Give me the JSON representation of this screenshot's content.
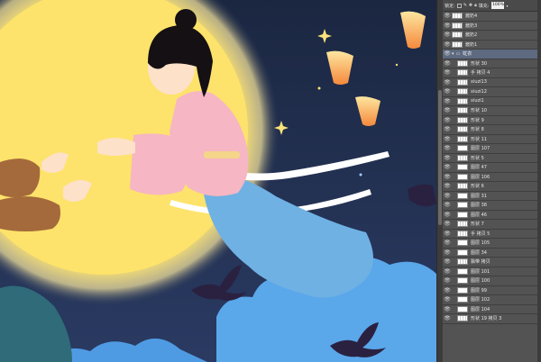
{
  "canvas": {
    "colors": {
      "sky": "#1f2d4a",
      "moon": "#fde36b",
      "cloud": "#5aa7ea",
      "lantern": "#f79a48",
      "robe_top": "#f6b6c3",
      "robe_skirt": "#6fb1e3"
    }
  },
  "panel": {
    "lock_label": "锁定:",
    "fill_label": "填充:",
    "fill_value": "100%",
    "layers": [
      {
        "name": "酱奶4",
        "type": "shape",
        "visible": true
      },
      {
        "name": "酱奶3",
        "type": "shape",
        "visible": true
      },
      {
        "name": "酱奶2",
        "type": "shape",
        "visible": true
      },
      {
        "name": "酱奶1",
        "type": "shape",
        "visible": true
      },
      {
        "name": "虹衣",
        "type": "group",
        "visible": true
      },
      {
        "name": "形状 30",
        "type": "shape",
        "visible": true
      },
      {
        "name": "手 拷贝 4",
        "type": "shape",
        "visible": true
      },
      {
        "name": "xiuzi13",
        "type": "shape",
        "visible": true
      },
      {
        "name": "xiuzi12",
        "type": "shape",
        "visible": true
      },
      {
        "name": "xiuzi1",
        "type": "shape",
        "visible": true
      },
      {
        "name": "形状 10",
        "type": "shape",
        "visible": true
      },
      {
        "name": "形状 9",
        "type": "shape",
        "visible": true
      },
      {
        "name": "形状 8",
        "type": "shape",
        "visible": true
      },
      {
        "name": "形状 11",
        "type": "shape",
        "visible": true
      },
      {
        "name": "图层 107",
        "type": "pixel",
        "visible": true
      },
      {
        "name": "形状 5",
        "type": "shape",
        "visible": true
      },
      {
        "name": "图层 47",
        "type": "pixel",
        "visible": true
      },
      {
        "name": "图层 106",
        "type": "pixel",
        "visible": true
      },
      {
        "name": "形状 6",
        "type": "shape",
        "visible": true
      },
      {
        "name": "图层 31",
        "type": "pixel",
        "visible": true
      },
      {
        "name": "图层 38",
        "type": "pixel",
        "visible": true
      },
      {
        "name": "图层 46",
        "type": "pixel",
        "visible": true
      },
      {
        "name": "形状 7",
        "type": "shape",
        "visible": true
      },
      {
        "name": "手 拷贝 5",
        "type": "shape",
        "visible": true
      },
      {
        "name": "图层 105",
        "type": "pixel",
        "visible": true
      },
      {
        "name": "图层 34",
        "type": "pixel",
        "visible": true
      },
      {
        "name": "飘带 拷贝",
        "type": "shape",
        "visible": true
      },
      {
        "name": "图层 101",
        "type": "pixel",
        "visible": true
      },
      {
        "name": "图层 100",
        "type": "pixel",
        "visible": true
      },
      {
        "name": "图层 99",
        "type": "pixel",
        "visible": true
      },
      {
        "name": "图层 102",
        "type": "pixel",
        "visible": true
      },
      {
        "name": "图层 104",
        "type": "pixel",
        "visible": true
      },
      {
        "name": "形状 19 拷贝 3",
        "type": "shape",
        "visible": true
      }
    ]
  }
}
